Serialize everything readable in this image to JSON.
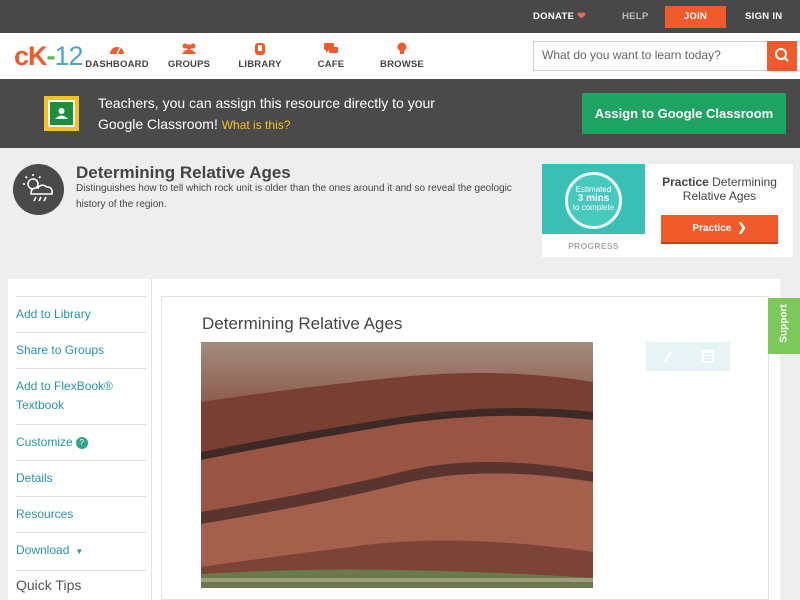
{
  "topbar": {
    "donate": "DONATE",
    "help": "HELP",
    "join": "JOIN",
    "signin": "SIGN IN"
  },
  "logo": {
    "a": "c",
    "b": "K",
    "c": "-",
    "d": "12"
  },
  "nav": [
    {
      "label": "DASHBOARD",
      "icon": "dashboard-icon"
    },
    {
      "label": "GROUPS",
      "icon": "groups-icon"
    },
    {
      "label": "LIBRARY",
      "icon": "library-icon"
    },
    {
      "label": "CAFE",
      "icon": "cafe-icon"
    },
    {
      "label": "BROWSE",
      "icon": "browse-icon"
    }
  ],
  "search": {
    "placeholder": "What do you want to learn today?"
  },
  "banner": {
    "text": "Teachers, you can assign this resource directly to your Google Classroom!",
    "link": "What is this?",
    "button": "Assign to Google Classroom"
  },
  "concept": {
    "title": "Determining Relative Ages",
    "description": "Distinguishes how to tell which rock unit is older than the ones around it and so reveal the geologic history of the region."
  },
  "practice": {
    "estimate_line1": "Estimated",
    "estimate_line2": "3 mins",
    "estimate_line3": "to complete",
    "progress_label": "PROGRESS",
    "title_bold": "Practice",
    "title_rest": "Determining Relative Ages",
    "button": "Practice"
  },
  "sidebar": {
    "items": [
      "Add to Library",
      "Share to Groups",
      "Add to FlexBook® Textbook",
      "Customize",
      "Details",
      "Resources",
      "Download"
    ],
    "help_glyph": "?",
    "caret": "▼",
    "quick_tips": "Quick Tips"
  },
  "content": {
    "title": "Determining Relative Ages"
  },
  "support": "Support",
  "colors": {
    "brand_orange": "#f15a2b",
    "brand_green": "#58b947",
    "teal_link": "#2a93a6",
    "assign_green": "#1ea362"
  }
}
